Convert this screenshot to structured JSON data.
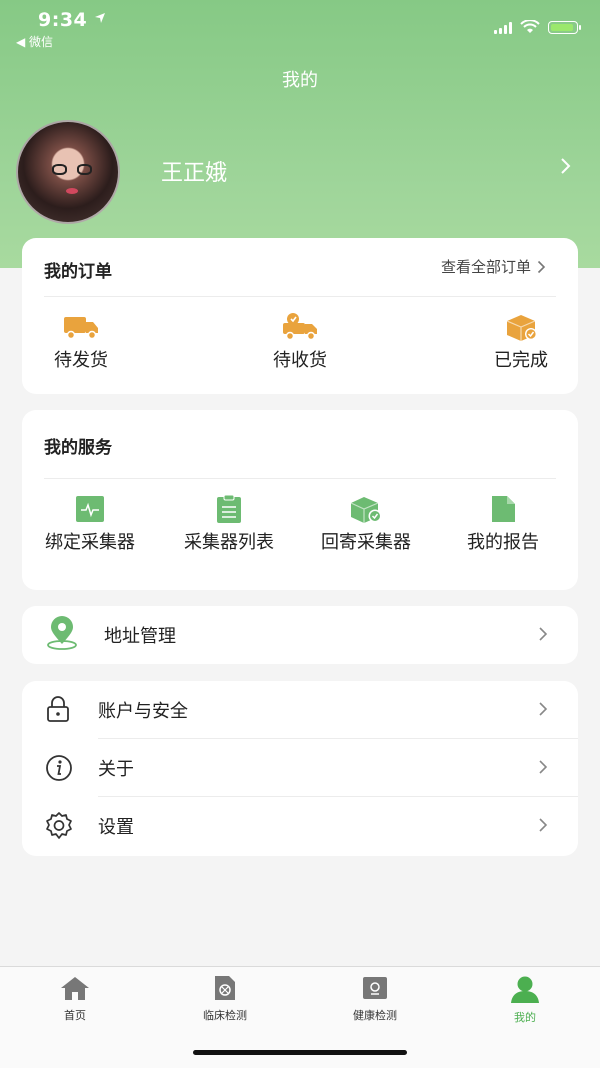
{
  "status_bar": {
    "time": "9:34",
    "back_app": "◀ 微信"
  },
  "page": {
    "title": "我的"
  },
  "user": {
    "name": "王正娥"
  },
  "orders": {
    "title": "我的订单",
    "view_all": "查看全部订单",
    "items": [
      {
        "label": "待发货",
        "icon": "truck-icon"
      },
      {
        "label": "待收货",
        "icon": "delivery-truck-icon"
      },
      {
        "label": "已完成",
        "icon": "package-done-icon"
      }
    ]
  },
  "services": {
    "title": "我的服务",
    "items": [
      {
        "label": "绑定采集器",
        "icon": "bind-device-icon"
      },
      {
        "label": "采集器列表",
        "icon": "clipboard-list-icon"
      },
      {
        "label": "回寄采集器",
        "icon": "return-box-icon"
      },
      {
        "label": "我的报告",
        "icon": "report-file-icon"
      }
    ]
  },
  "address": {
    "label": "地址管理",
    "icon": "location-pin-icon"
  },
  "settings_list": [
    {
      "label": "账户与安全",
      "icon": "lock-icon"
    },
    {
      "label": "关于",
      "icon": "info-icon"
    },
    {
      "label": "设置",
      "icon": "gear-icon"
    }
  ],
  "tabbar": {
    "items": [
      {
        "label": "首页",
        "icon": "home-icon"
      },
      {
        "label": "临床检测",
        "icon": "clinical-test-icon"
      },
      {
        "label": "健康检测",
        "icon": "health-test-icon"
      },
      {
        "label": "我的",
        "icon": "profile-icon",
        "active": true
      }
    ]
  },
  "colors": {
    "accent": "#4caf50",
    "header": "#86c985",
    "order_icon": "#e9a33d",
    "service_icon": "#6dbb72"
  }
}
